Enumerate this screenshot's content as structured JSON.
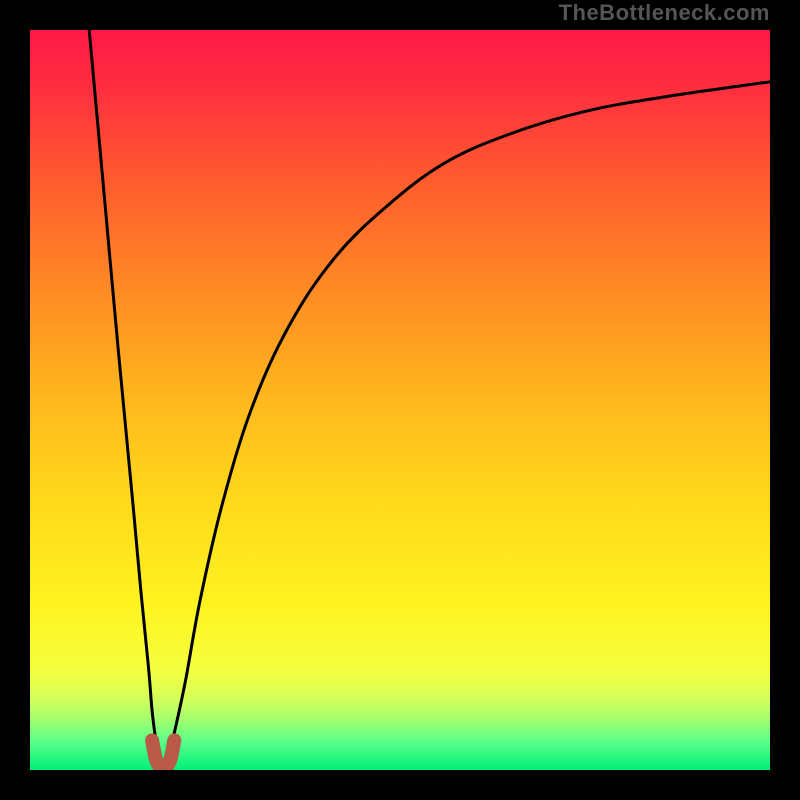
{
  "watermark": "TheBottleneck.com",
  "chart_data": {
    "type": "line",
    "title": "",
    "xlabel": "",
    "ylabel": "",
    "xlim": [
      0,
      100
    ],
    "ylim": [
      0,
      100
    ],
    "grid": false,
    "legend": null,
    "annotations": [],
    "background": {
      "type": "vertical-gradient",
      "stops": [
        {
          "offset": 0.0,
          "color": "#ff1846"
        },
        {
          "offset": 0.08,
          "color": "#ff2f3f"
        },
        {
          "offset": 0.2,
          "color": "#ff5a2e"
        },
        {
          "offset": 0.35,
          "color": "#ff8a24"
        },
        {
          "offset": 0.5,
          "color": "#ffb81d"
        },
        {
          "offset": 0.65,
          "color": "#ffdc1b"
        },
        {
          "offset": 0.78,
          "color": "#fff321"
        },
        {
          "offset": 0.86,
          "color": "#f6ff3d"
        },
        {
          "offset": 0.9,
          "color": "#d8ff55"
        },
        {
          "offset": 0.93,
          "color": "#a6ff6e"
        },
        {
          "offset": 0.96,
          "color": "#5eff88"
        },
        {
          "offset": 1.0,
          "color": "#00f07a"
        }
      ]
    },
    "series": [
      {
        "name": "left-descent",
        "x": [
          8,
          10,
          12,
          14,
          15,
          16,
          16.5,
          17,
          17.3
        ],
        "y": [
          100,
          78,
          56,
          35,
          24,
          14,
          8,
          4,
          2
        ]
      },
      {
        "name": "right-ascent",
        "x": [
          18.8,
          19.5,
          21,
          23,
          26,
          30,
          35,
          41,
          48,
          56,
          65,
          75,
          86,
          100
        ],
        "y": [
          2,
          5,
          12,
          23,
          36,
          49,
          60,
          69,
          76,
          82,
          86,
          89,
          91,
          93
        ]
      }
    ],
    "cusp_marker": {
      "x": [
        16.5,
        17,
        17.5,
        18,
        18.5,
        19,
        19.5
      ],
      "y": [
        4,
        1.5,
        0.5,
        0.3,
        0.5,
        1.5,
        4
      ],
      "color": "#b85a47",
      "width": 14
    }
  }
}
